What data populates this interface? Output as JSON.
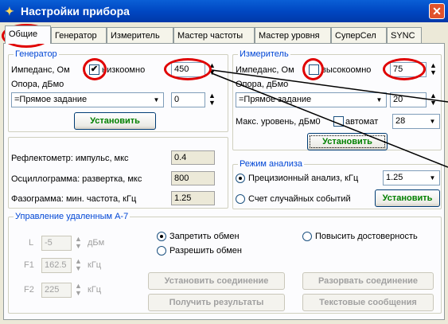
{
  "window": {
    "title": "Настройки прибора",
    "close_label": "✕"
  },
  "tabs": [
    "Общие",
    "Генератор",
    "Измеритель",
    "Мастер частоты",
    "Мастер уровня",
    "СуперСел",
    "SYNC"
  ],
  "generator": {
    "legend": "Генератор",
    "impedance_label": "Импеданс, Ом",
    "low_impedance_checked": true,
    "low_impedance_label": "низкоомно",
    "impedance_value": "450",
    "reference_label": "Опора, дБмо",
    "reference_mode": "=Прямое задание",
    "reference_value": "0",
    "set_button": "Установить"
  },
  "meter": {
    "legend": "Измеритель",
    "impedance_label": "Импеданс, Ом",
    "high_impedance_checked": false,
    "high_impedance_label": "высокоомно",
    "impedance_value": "75",
    "reference_label": "Опора, дБмо",
    "reference_mode": "=Прямое задание",
    "reference_value": "20",
    "max_level_label": "Макс. уровень, дБм0",
    "auto_checked": false,
    "auto_label": "автомат",
    "max_level_value": "28",
    "set_button": "Установить"
  },
  "readouts": [
    {
      "label": "Рефлектометр: импульс, мкс",
      "value": "0.4"
    },
    {
      "label": "Осциллограмма: развертка, мкс",
      "value": "800"
    },
    {
      "label": "Фазограмма: мин. частота, кГц",
      "value": "1.25"
    }
  ],
  "analysis": {
    "legend": "Режим анализа",
    "precision_label": "Прецизионный анализ, кГц",
    "precision_selected": true,
    "precision_value": "1.25",
    "random_label": "Счет случайных событий",
    "random_selected": false,
    "set_button": "Установить"
  },
  "remote": {
    "legend": "Управление удаленным А-7",
    "fields": [
      {
        "label": "L",
        "value": "-5",
        "unit": "дБм"
      },
      {
        "label": "F1",
        "value": "162.5",
        "unit": "кГц"
      },
      {
        "label": "F2",
        "value": "225",
        "unit": "кГц"
      }
    ],
    "deny_exchange": "Запретить обмен",
    "allow_exchange": "Разрешить обмен",
    "increase_reliability": "Повысить достоверность",
    "connect_button": "Установить соединение",
    "disconnect_button": "Разорвать соединение",
    "get_results_button": "Получить результаты",
    "text_messages_button": "Текстовые сообщения"
  },
  "colors": {
    "accent_title": "#0047c2",
    "highlight_ring": "#e00000",
    "button_text": "#008000",
    "legend_text": "#0046d5"
  }
}
